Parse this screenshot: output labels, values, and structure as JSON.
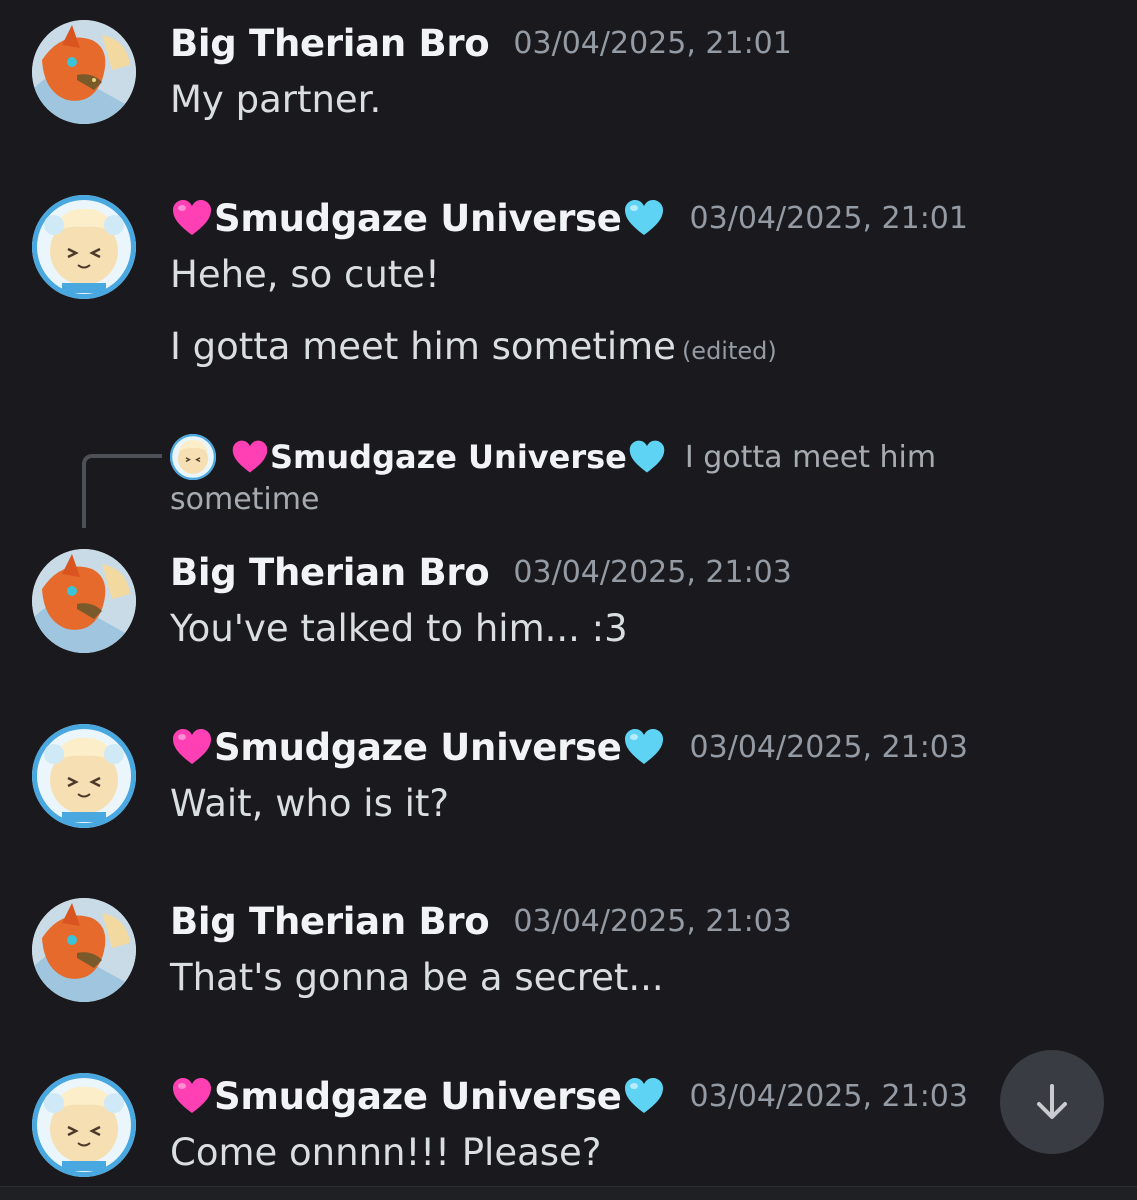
{
  "messages": [
    {
      "author": "Big Therian Bro",
      "timestamp": "03/04/2025, 21:01",
      "lines": [
        "My partner."
      ]
    },
    {
      "author": "Smudgaze Universe",
      "timestamp": "03/04/2025, 21:01",
      "lines": [
        "Hehe, so cute!",
        "I gotta meet him sometime"
      ],
      "edited_label": "(edited)"
    },
    {
      "author": "Big Therian Bro",
      "timestamp": "03/04/2025, 21:03",
      "lines": [
        "You've talked to him... :3"
      ],
      "reply": {
        "author": "Smudgaze Universe",
        "preview_line1": "I gotta meet him",
        "preview_line2": "sometime"
      }
    },
    {
      "author": "Smudgaze Universe",
      "timestamp": "03/04/2025, 21:03",
      "lines": [
        "Wait, who is it?"
      ]
    },
    {
      "author": "Big Therian Bro",
      "timestamp": "03/04/2025, 21:03",
      "lines": [
        "That's gonna be a secret..."
      ]
    },
    {
      "author": "Smudgaze Universe",
      "timestamp": "03/04/2025, 21:03",
      "lines": [
        "Come onnnn!!! Please?"
      ]
    }
  ],
  "icons": {
    "pink_heart": "pink-heart-emoji",
    "blue_heart": "light-blue-heart-emoji",
    "scroll_down": "arrow-down-icon"
  },
  "colors": {
    "background": "#1a1a1e",
    "username": "#f2f3f5",
    "timestamp": "#949ba4",
    "pink_heart": "#ff3fb4",
    "blue_heart": "#5fd3f3"
  }
}
